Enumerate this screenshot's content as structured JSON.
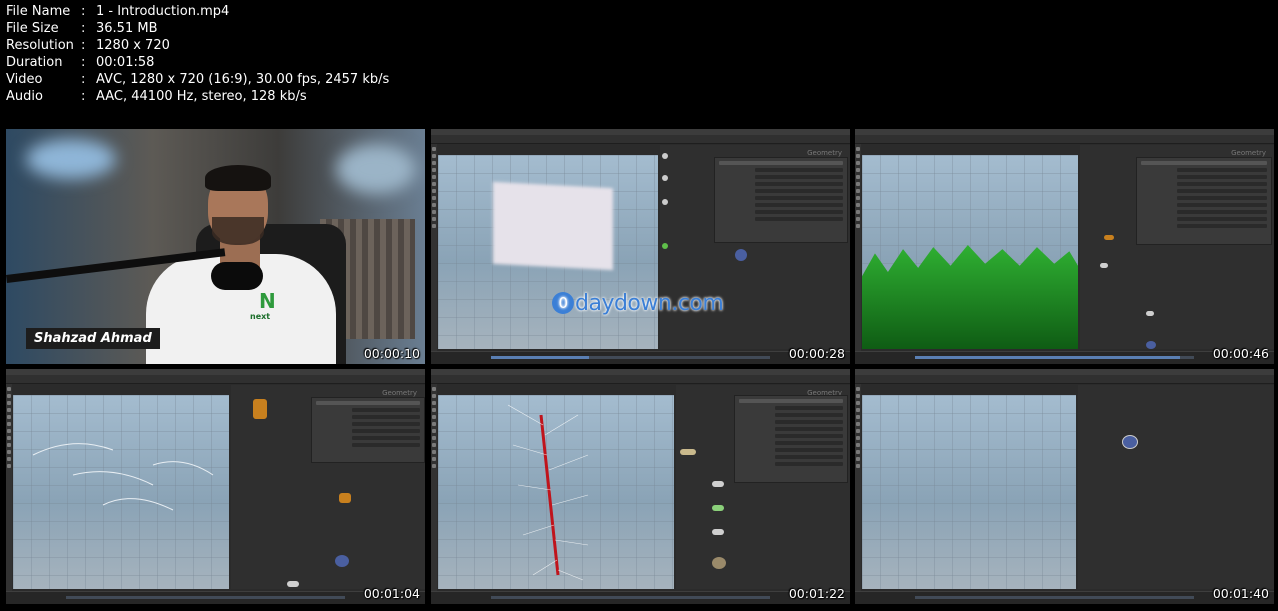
{
  "file_info": [
    {
      "label": "File Name",
      "value": "1 - Introduction.mp4"
    },
    {
      "label": "File Size",
      "value": "36.51 MB"
    },
    {
      "label": "Resolution",
      "value": "1280 x 720"
    },
    {
      "label": "Duration",
      "value": "00:01:58"
    },
    {
      "label": "Video",
      "value": "AVC, 1280 x 720 (16:9), 30.00 fps, 2457 kb/s"
    },
    {
      "label": "Audio",
      "value": "AAC, 44100 Hz, stereo, 128 kb/s"
    }
  ],
  "separator": ":",
  "thumbnails": [
    {
      "timestamp": "00:00:10",
      "caption": "Shahzad Ahmad"
    },
    {
      "timestamp": "00:00:28",
      "watermark": "daydown.com",
      "watermark_icon": "0",
      "network_label": "Geometry"
    },
    {
      "timestamp": "00:00:46",
      "network_label": "Geometry"
    },
    {
      "timestamp": "00:01:04",
      "network_label": "Geometry"
    },
    {
      "timestamp": "00:01:22",
      "network_label": "Geometry"
    },
    {
      "timestamp": "00:01:40"
    }
  ],
  "logo": {
    "mark": "N",
    "text": "next"
  },
  "colors": {
    "grass": "#1f8a22",
    "node_orange": "#c8801e",
    "node_gray": "#cfcfcf",
    "strand_red": "#c0141c",
    "watermark": "#3b7fd6"
  }
}
